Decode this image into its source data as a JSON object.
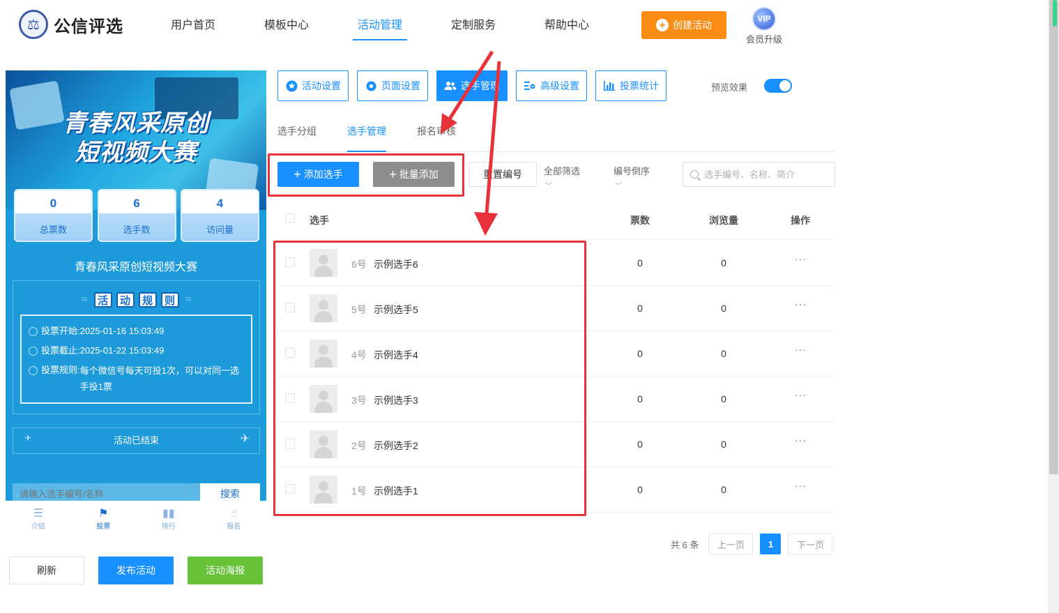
{
  "header": {
    "logo_text": "公信评选",
    "nav": [
      "用户首页",
      "模板中心",
      "活动管理",
      "定制服务",
      "帮助中心"
    ],
    "active_nav_index": 2,
    "create_label": "创建活动",
    "vip_badge": "VIP",
    "vip_label": "会员升级"
  },
  "phone": {
    "banner_line1": "青春风采原创",
    "banner_line2": "短视频大赛",
    "stats": [
      {
        "value": "0",
        "label": "总票数"
      },
      {
        "value": "6",
        "label": "选手数"
      },
      {
        "value": "4",
        "label": "访问量"
      }
    ],
    "title": "青春风采原创短视频大赛",
    "rules_chars": [
      "活",
      "动",
      "规",
      "则"
    ],
    "rules": [
      {
        "label": "投票开始:",
        "value": "2025-01-16 15:03:49"
      },
      {
        "label": "投票截止:",
        "value": "2025-01-22 15:03:49"
      },
      {
        "label": "投票规则:",
        "value": "每个微信号每天可投1次，可以对同一选手投1票"
      }
    ],
    "status": "活动已结束",
    "search_placeholder": "请输入选手编号/名称",
    "search_button": "搜索",
    "tabs": [
      "介绍",
      "投票",
      "排行",
      "报名"
    ],
    "active_tab_index": 1
  },
  "bottom_buttons": {
    "refresh": "刷新",
    "publish": "发布活动",
    "poster": "活动海报"
  },
  "settings_tabs": [
    "活动设置",
    "页面设置",
    "选手管理",
    "高级设置",
    "投票统计"
  ],
  "active_settings_index": 2,
  "preview_label": "预览效果",
  "preview_on": true,
  "sub_tabs": [
    "选手分组",
    "选手管理",
    "报名审核"
  ],
  "active_sub_index": 1,
  "toolbar": {
    "add": "添加选手",
    "batch": "批量添加",
    "renumber": "重置编号",
    "filter": "全部筛选",
    "sort": "编号倒序",
    "search_placeholder": "选手编号、名称、简介"
  },
  "table": {
    "columns": {
      "player": "选手",
      "votes": "票数",
      "views": "浏览量",
      "actions": "操作"
    },
    "rows": [
      {
        "num": "6号",
        "name": "示例选手6",
        "votes": "0",
        "views": "0"
      },
      {
        "num": "5号",
        "name": "示例选手5",
        "votes": "0",
        "views": "0"
      },
      {
        "num": "4号",
        "name": "示例选手4",
        "votes": "0",
        "views": "0"
      },
      {
        "num": "3号",
        "name": "示例选手3",
        "votes": "0",
        "views": "0"
      },
      {
        "num": "2号",
        "name": "示例选手2",
        "votes": "0",
        "views": "0"
      },
      {
        "num": "1号",
        "name": "示例选手1",
        "votes": "0",
        "views": "0"
      }
    ],
    "more_glyph": "···"
  },
  "pagination": {
    "total": "共 6 条",
    "prev": "上一页",
    "current": "1",
    "next": "下一页"
  },
  "colors": {
    "primary": "#1890ff",
    "orange": "#fa8c16",
    "green": "#67c23a",
    "annotation_red": "#e8323a"
  }
}
